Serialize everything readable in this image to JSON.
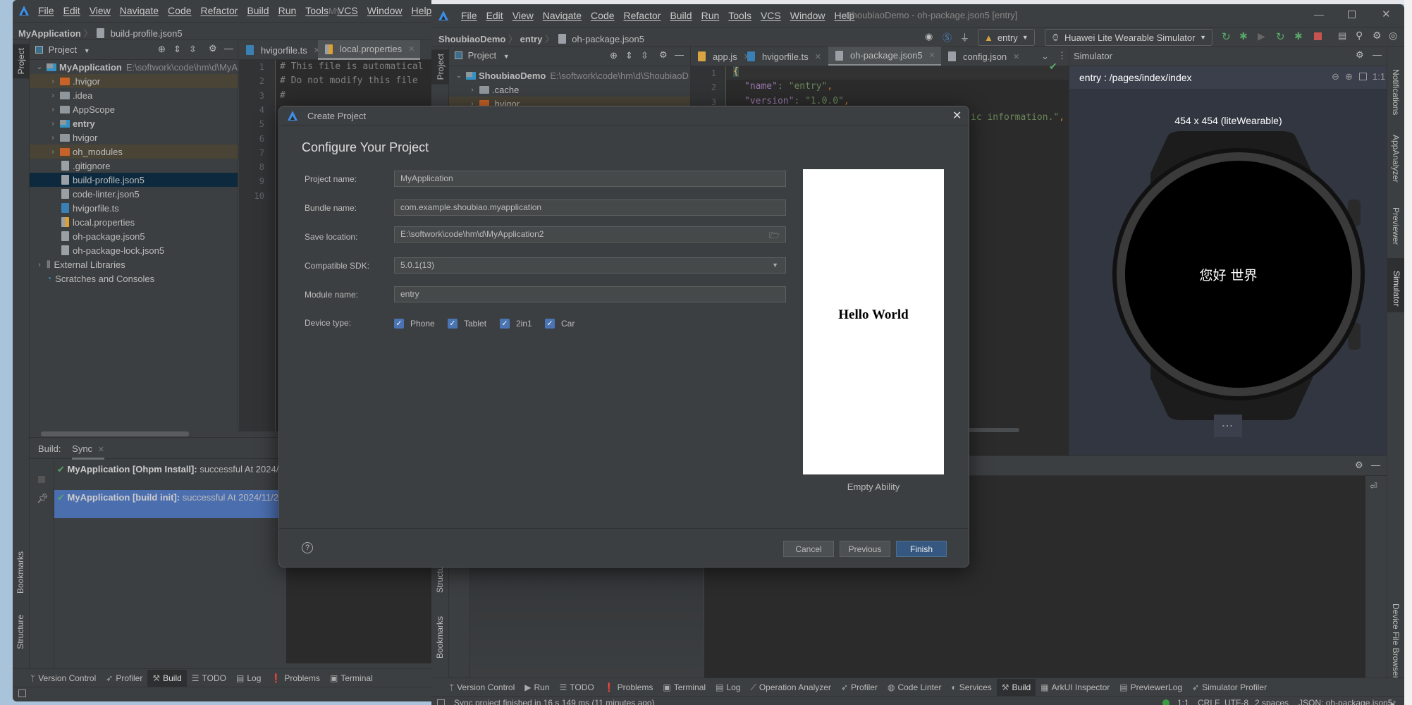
{
  "window1": {
    "title_partial": "My",
    "menu": [
      "File",
      "Edit",
      "View",
      "Navigate",
      "Code",
      "Refactor",
      "Build",
      "Run",
      "Tools",
      "VCS",
      "Window",
      "Help"
    ],
    "breadcrumb": {
      "project": "MyApplication",
      "file": "build-profile.json5"
    },
    "project_panel_title": "Project",
    "tree": [
      {
        "label": "MyApplication",
        "path": "E:\\softwork\\code\\hm\\d\\MyA",
        "icon": "module-folder",
        "depth": 0,
        "arrow": "down",
        "bold": true
      },
      {
        "label": ".hvigor",
        "icon": "excluded-folder",
        "depth": 1,
        "arrow": "right",
        "state": "excluded"
      },
      {
        "label": ".idea",
        "icon": "folder",
        "depth": 1,
        "arrow": "right"
      },
      {
        "label": "AppScope",
        "icon": "folder",
        "depth": 1,
        "arrow": "right"
      },
      {
        "label": "entry",
        "icon": "module-folder",
        "depth": 1,
        "arrow": "right",
        "bold": true
      },
      {
        "label": "hvigor",
        "icon": "folder",
        "depth": 1,
        "arrow": "right"
      },
      {
        "label": "oh_modules",
        "icon": "excluded-folder",
        "depth": 1,
        "arrow": "right",
        "state": "excluded"
      },
      {
        "label": ".gitignore",
        "icon": "file",
        "depth": 1
      },
      {
        "label": "build-profile.json5",
        "icon": "json-file",
        "depth": 1,
        "state": "selected"
      },
      {
        "label": "code-linter.json5",
        "icon": "json-file",
        "depth": 1
      },
      {
        "label": "hvigorfile.ts",
        "icon": "ts-file",
        "depth": 1
      },
      {
        "label": "local.properties",
        "icon": "properties-file",
        "depth": 1
      },
      {
        "label": "oh-package.json5",
        "icon": "json-file",
        "depth": 1
      },
      {
        "label": "oh-package-lock.json5",
        "icon": "json-file",
        "depth": 1
      },
      {
        "label": "External Libraries",
        "icon": "library",
        "depth": 0,
        "arrow": "right"
      },
      {
        "label": "Scratches and Consoles",
        "icon": "scratches",
        "depth": 0
      }
    ],
    "editor_tabs": [
      {
        "label": "hvigorfile.ts",
        "icon": "ts-file"
      },
      {
        "label": "local.properties",
        "icon": "properties-file",
        "active": true
      }
    ],
    "line_numbers": [
      "1",
      "2",
      "3",
      "4",
      "5",
      "6",
      "7",
      "8",
      "9",
      "10"
    ],
    "code_lines": [
      "# This file is automatical",
      "# Do not modify this file",
      "#"
    ],
    "vertical_tabs": {
      "project": "Project",
      "bookmarks": "Bookmarks",
      "structure": "Structure"
    },
    "build": {
      "label": "Build:",
      "tab": "Sync",
      "rows": [
        {
          "name": "MyApplication [Ohpm Install]:",
          "status": "successful At 2024/1"
        },
        {
          "name": "MyApplication [build init]:",
          "status": "successful At 2024/11/2",
          "selected": true
        }
      ]
    },
    "bottom_tools": [
      {
        "label": "Version Control",
        "icon": "branch-icon"
      },
      {
        "label": "Profiler",
        "icon": "profiler-icon"
      },
      {
        "label": "Build",
        "icon": "hammer-icon",
        "active": true
      },
      {
        "label": "TODO",
        "icon": "list-icon"
      },
      {
        "label": "Log",
        "icon": "log-icon"
      },
      {
        "label": "Problems",
        "icon": "problems-icon"
      },
      {
        "label": "Terminal",
        "icon": "terminal-icon"
      }
    ]
  },
  "window2": {
    "title": "ShoubiaoDemo - oh-package.json5 [entry]",
    "menu": [
      "File",
      "Edit",
      "View",
      "Navigate",
      "Code",
      "Refactor",
      "Build",
      "Run",
      "Tools",
      "VCS",
      "Window",
      "Help"
    ],
    "breadcrumb": {
      "project": "ShoubiaoDemo",
      "module": "entry",
      "file": "oh-package.json5"
    },
    "module_selector": "entry",
    "device_selector": "Huawei Lite Wearable Simulator",
    "project_panel_title": "Project",
    "tree": [
      {
        "label": "ShoubiaoDemo",
        "path": "E:\\softwork\\code\\hm\\d\\ShoubiaoD",
        "icon": "module-folder",
        "depth": 0,
        "arrow": "down",
        "bold": true
      },
      {
        "label": ".cache",
        "icon": "folder",
        "depth": 1,
        "arrow": "right"
      },
      {
        "label": ".hvigor",
        "icon": "excluded-folder",
        "depth": 1,
        "arrow": "right",
        "state": "excluded"
      }
    ],
    "editor_tabs": [
      {
        "label": "app.js",
        "icon": "js-file"
      },
      {
        "label": "hvigorfile.ts",
        "icon": "ts-file"
      },
      {
        "label": "oh-package.json5",
        "icon": "json-file",
        "active": true
      },
      {
        "label": "config.json",
        "icon": "json-file"
      }
    ],
    "line_numbers": [
      "1",
      "2",
      "3"
    ],
    "code": {
      "line1": "{",
      "line2_key": "\"name\"",
      "line2_value": "\"entry\"",
      "line3_key": "\"version\"",
      "line3_value": "\"1.0.0\"",
      "line4_partial": "ic information.\""
    },
    "vertical_tabs": {
      "project": "Project",
      "structure": "Structure",
      "bookmarks": "Bookmarks"
    },
    "right_tabs": {
      "notifications": "Notifications",
      "app_analyzer": "AppAnalyzer",
      "previewer": "Previewer",
      "simulator": "Simulator",
      "device_file_browser": "Device File Browser"
    },
    "simulator": {
      "title": "Simulator",
      "page_path": "entry : /pages/index/index",
      "resolution": "454 x 454 (liteWearable)",
      "screen_text": "您好 世界",
      "zoom_reset": "1:1",
      "more": "..."
    },
    "bottom_tools": [
      {
        "label": "Version Control",
        "icon": "branch-icon"
      },
      {
        "label": "Run",
        "icon": "run-icon"
      },
      {
        "label": "TODO",
        "icon": "list-icon"
      },
      {
        "label": "Problems",
        "icon": "problems-icon"
      },
      {
        "label": "Terminal",
        "icon": "terminal-icon"
      },
      {
        "label": "Log",
        "icon": "log-icon"
      },
      {
        "label": "Operation Analyzer",
        "icon": "chart-icon"
      },
      {
        "label": "Profiler",
        "icon": "profiler-icon"
      },
      {
        "label": "Code Linter",
        "icon": "linter-icon"
      },
      {
        "label": "Services",
        "icon": "services-icon"
      },
      {
        "label": "Build",
        "icon": "hammer-icon",
        "active": true
      },
      {
        "label": "ArkUI Inspector",
        "icon": "inspector-icon"
      },
      {
        "label": "PreviewerLog",
        "icon": "log-icon"
      },
      {
        "label": "Simulator Profiler",
        "icon": "profiler-icon"
      }
    ],
    "status": {
      "message": "Sync project finished in 16 s 149 ms (11 minutes ago)",
      "position": "1:1",
      "line_ending": "CRLF",
      "encoding": "UTF-8",
      "indent": "2 spaces",
      "file_type": "JSON: oh-package.json5"
    }
  },
  "dialog": {
    "title": "Create Project",
    "heading": "Configure Your Project",
    "fields": {
      "project_name": {
        "label": "Project name:",
        "value": "MyApplication"
      },
      "bundle_name": {
        "label": "Bundle name:",
        "value": "com.example.shoubiao.myapplication"
      },
      "save_location": {
        "label": "Save location:",
        "value": "E:\\softwork\\code\\hm\\d\\MyApplication2"
      },
      "compatible_sdk": {
        "label": "Compatible SDK:",
        "value": "5.0.1(13)"
      },
      "module_name": {
        "label": "Module name:",
        "value": "entry"
      }
    },
    "device_type": {
      "label": "Device type:",
      "options": [
        {
          "label": "Phone",
          "checked": true
        },
        {
          "label": "Tablet",
          "checked": true
        },
        {
          "label": "2in1",
          "checked": true
        },
        {
          "label": "Car",
          "checked": true
        }
      ]
    },
    "preview": {
      "text": "Hello World",
      "template": "Empty Ability"
    },
    "buttons": {
      "cancel": "Cancel",
      "previous": "Previous",
      "finish": "Finish"
    }
  },
  "colors": {
    "accent": "#365880",
    "selection": "#4b6eaf",
    "tree_selected": "#0d293e",
    "excluded_bg": "#4a4437",
    "success": "#59a869",
    "stop": "#c75450"
  }
}
